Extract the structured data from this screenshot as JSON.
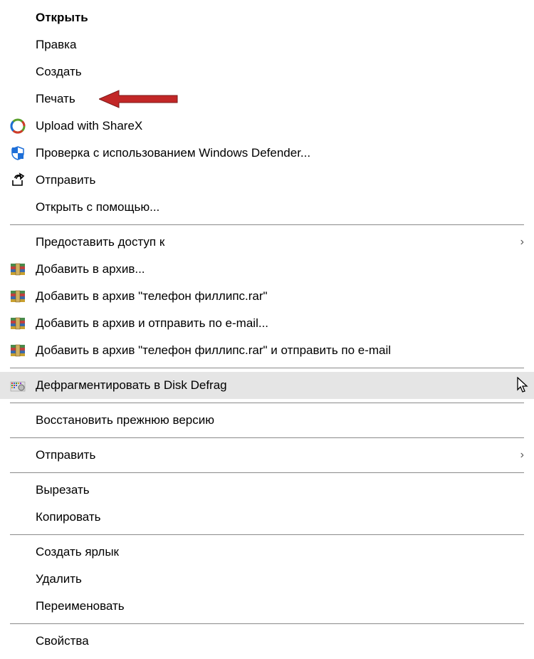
{
  "menu": {
    "items": [
      {
        "label": "Открыть",
        "bold": true
      },
      {
        "label": "Правка"
      },
      {
        "label": "Создать"
      },
      {
        "label": "Печать",
        "annotation": "arrow"
      },
      {
        "label": "Upload with ShareX",
        "icon": "sharex"
      },
      {
        "label": "Проверка с использованием Windows Defender...",
        "icon": "defender"
      },
      {
        "label": "Отправить",
        "icon": "share-out"
      },
      {
        "label": "Открыть с помощью..."
      },
      {
        "separator": true
      },
      {
        "label": "Предоставить доступ к",
        "submenu": true
      },
      {
        "label": "Добавить в архив...",
        "icon": "winrar"
      },
      {
        "label": "Добавить в архив \"телефон филлипс.rar\"",
        "icon": "winrar"
      },
      {
        "label": "Добавить в архив и отправить по e-mail...",
        "icon": "winrar"
      },
      {
        "label": "Добавить в архив \"телефон филлипс.rar\" и отправить по e-mail",
        "icon": "winrar"
      },
      {
        "separator": true
      },
      {
        "label": "Дефрагментировать в Disk Defrag",
        "icon": "defrag",
        "highlighted": true,
        "cursor": true
      },
      {
        "separator": true
      },
      {
        "label": "Восстановить прежнюю версию"
      },
      {
        "separator": true
      },
      {
        "label": "Отправить",
        "submenu": true
      },
      {
        "separator": true
      },
      {
        "label": "Вырезать"
      },
      {
        "label": "Копировать"
      },
      {
        "separator": true
      },
      {
        "label": "Создать ярлык"
      },
      {
        "label": "Удалить"
      },
      {
        "label": "Переименовать"
      },
      {
        "separator": true
      },
      {
        "label": "Свойства"
      }
    ]
  },
  "annotations": {
    "arrow_color": "#c22727"
  }
}
